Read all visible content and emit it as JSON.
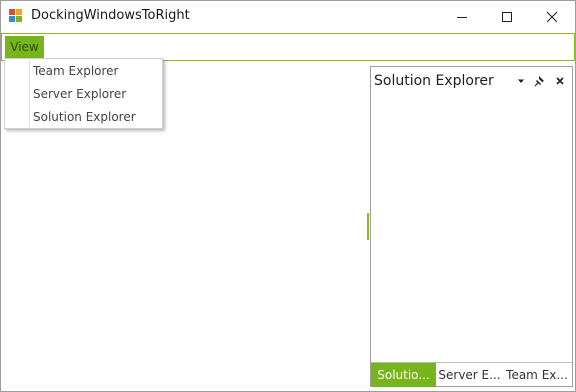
{
  "window": {
    "title": "DockingWindowsToRight",
    "controls": {
      "minimize": "minimize",
      "maximize": "maximize",
      "close": "close"
    }
  },
  "menubar": {
    "items": [
      {
        "label": "View",
        "expanded": true
      }
    ]
  },
  "view_menu": {
    "items": [
      {
        "label": "Team Explorer"
      },
      {
        "label": "Server Explorer"
      },
      {
        "label": "Solution Explorer"
      }
    ]
  },
  "dock_panel": {
    "title": "Solution Explorer",
    "header_icons": [
      "dropdown-arrow-icon",
      "pin-icon",
      "close-icon"
    ]
  },
  "dock_tabs": [
    {
      "label": "Solutio...",
      "active": true
    },
    {
      "label": "Server E...",
      "active": false
    },
    {
      "label": "Team Ex...",
      "active": false
    }
  ],
  "colors": {
    "accent": "#78b51c",
    "accent_border": "#8dbb1f",
    "window_border": "#9e9e9e"
  }
}
